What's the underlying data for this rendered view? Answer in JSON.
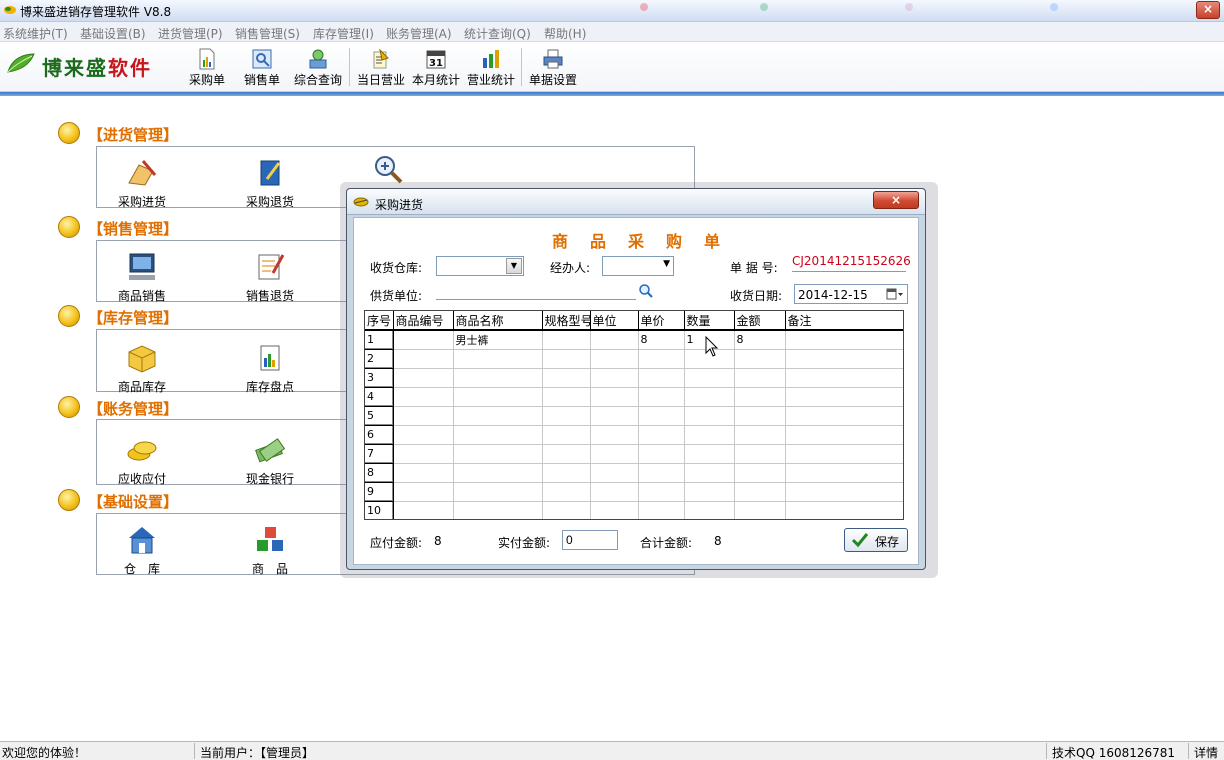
{
  "window": {
    "title": "博来盛进销存管理软件 V8.8",
    "close_glyph": "×"
  },
  "menu": [
    {
      "label": "系统维护(T)"
    },
    {
      "label": "基础设置(B)"
    },
    {
      "label": "进货管理(P)"
    },
    {
      "label": "销售管理(S)"
    },
    {
      "label": "库存管理(I)"
    },
    {
      "label": "账务管理(A)"
    },
    {
      "label": "统计查询(Q)"
    },
    {
      "label": "帮助(H)"
    }
  ],
  "logo": {
    "text_green": "博来盛",
    "text_red": "软件"
  },
  "toolbar": [
    {
      "label": "采购单",
      "icon": "purchase-order-icon"
    },
    {
      "label": "销售单",
      "icon": "sales-order-icon"
    },
    {
      "label": "综合查询",
      "icon": "query-icon"
    },
    {
      "label": "当日营业",
      "icon": "daily-business-icon"
    },
    {
      "label": "本月统计",
      "icon": "calendar-31-icon",
      "calendar_day": "31"
    },
    {
      "label": "营业统计",
      "icon": "business-stats-icon"
    },
    {
      "label": "单据设置",
      "icon": "printer-icon"
    }
  ],
  "modules": [
    {
      "title": "【进货管理】",
      "items": [
        {
          "label": "采购进货",
          "icon": "purchase-in-icon"
        },
        {
          "label": "采购退货",
          "icon": "purchase-return-icon"
        },
        {
          "label": "",
          "icon": "magnifier-icon"
        }
      ]
    },
    {
      "title": "【销售管理】",
      "items": [
        {
          "label": "商品销售",
          "icon": "computer-icon"
        },
        {
          "label": "销售退货",
          "icon": "sales-return-icon"
        }
      ]
    },
    {
      "title": "【库存管理】",
      "items": [
        {
          "label": "商品库存",
          "icon": "box-icon"
        },
        {
          "label": "库存盘点",
          "icon": "inventory-chart-icon"
        }
      ]
    },
    {
      "title": "【账务管理】",
      "items": [
        {
          "label": "应收应付",
          "icon": "coins-icon"
        },
        {
          "label": "现金银行",
          "icon": "cash-icon"
        }
      ]
    },
    {
      "title": "【基础设置】",
      "items": [
        {
          "label": "仓　库",
          "icon": "warehouse-icon"
        },
        {
          "label": "商　品",
          "icon": "cubes-icon"
        }
      ]
    }
  ],
  "dialog": {
    "title": "采购进货",
    "close_glyph": "×",
    "form_title": "商品采购单",
    "warehouse_label": "收货仓库:",
    "warehouse_value": "",
    "handler_label": "经办人:",
    "handler_value": "",
    "doc_no_label": "单 据 号:",
    "doc_no_value": "CJ20141215152626",
    "supplier_label": "供货单位:",
    "supplier_value": "",
    "date_label": "收货日期:",
    "date_value": "2014-12-15",
    "columns": [
      "序号",
      "商品编号",
      "商品名称",
      "规格型号",
      "单位",
      "单价",
      "数量",
      "金额",
      "备注"
    ],
    "rows": [
      [
        "1",
        "",
        "男士裤",
        "",
        "",
        "8",
        "1",
        "8",
        ""
      ],
      [
        "2",
        "",
        "",
        "",
        "",
        "",
        "",
        "",
        ""
      ],
      [
        "3",
        "",
        "",
        "",
        "",
        "",
        "",
        "",
        ""
      ],
      [
        "4",
        "",
        "",
        "",
        "",
        "",
        "",
        "",
        ""
      ],
      [
        "5",
        "",
        "",
        "",
        "",
        "",
        "",
        "",
        ""
      ],
      [
        "6",
        "",
        "",
        "",
        "",
        "",
        "",
        "",
        ""
      ],
      [
        "7",
        "",
        "",
        "",
        "",
        "",
        "",
        "",
        ""
      ],
      [
        "8",
        "",
        "",
        "",
        "",
        "",
        "",
        "",
        ""
      ],
      [
        "9",
        "",
        "",
        "",
        "",
        "",
        "",
        "",
        ""
      ],
      [
        "10",
        "",
        "",
        "",
        "",
        "",
        "",
        "",
        ""
      ]
    ],
    "payable_label": "应付金额:",
    "payable_value": "8",
    "paid_label": "实付金额:",
    "paid_value": "0",
    "total_label": "合计金额:",
    "total_value": "8",
    "save_label": "保存"
  },
  "status": {
    "welcome": "欢迎您的体验！",
    "current_user": "当前用户：【管理员】",
    "qq": "技术QQ 1608126781",
    "detail": "详情"
  },
  "colors": {
    "accent_orange": "#e06f00",
    "doc_red": "#d0021b",
    "logo_green": "#1c6a1c"
  }
}
